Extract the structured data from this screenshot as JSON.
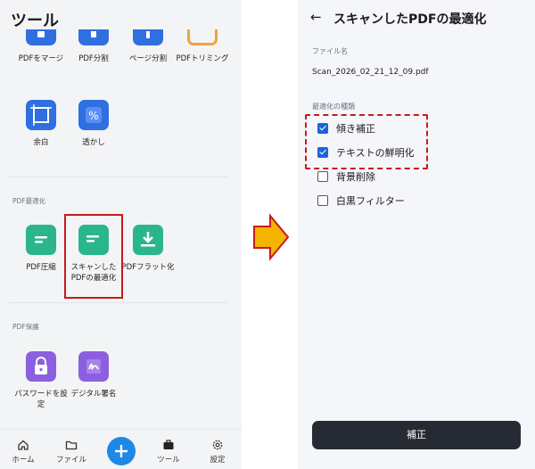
{
  "left_screen": {
    "title": "ツール",
    "top_tools": [
      {
        "label": "PDFをマージ"
      },
      {
        "label": "PDF分割"
      },
      {
        "label": "ページ分割"
      },
      {
        "label": "PDFトリミング"
      }
    ],
    "row2_tools": [
      {
        "label": "余白"
      },
      {
        "label": "透かし"
      }
    ],
    "section_optimize": "PDF最適化",
    "optimize_tools": [
      {
        "label": "PDF圧縮"
      },
      {
        "label_line1": "スキャンした",
        "label_line2": "PDFの最適化"
      },
      {
        "label": "PDFフラット化"
      }
    ],
    "section_protect": "PDF保護",
    "protect_tools": [
      {
        "label_line1": "パスワードを設",
        "label_line2": "定"
      },
      {
        "label": "デジタル署名"
      }
    ],
    "nav": {
      "home": "ホーム",
      "file": "ファイル",
      "tools": "ツール",
      "settings": "設定"
    }
  },
  "right_screen": {
    "title": "スキャンしたPDFの最適化",
    "file_name_label": "ファイル名",
    "file_name": "Scan_2026_02_21_12_09.pdf",
    "optimization_type_label": "最適化の種類",
    "options": [
      {
        "label": "傾き補正",
        "checked": true
      },
      {
        "label": "テキストの鮮明化",
        "checked": true
      },
      {
        "label": "背景削除",
        "checked": false
      },
      {
        "label": "白黒フィルター",
        "checked": false
      }
    ],
    "action_button": "補正"
  },
  "colors": {
    "highlight": "#c51b1b",
    "arrow_fill": "#f5b400",
    "checkbox_checked": "#1e63d6",
    "primary_button": "#262a33",
    "fab": "#1e88e5"
  }
}
